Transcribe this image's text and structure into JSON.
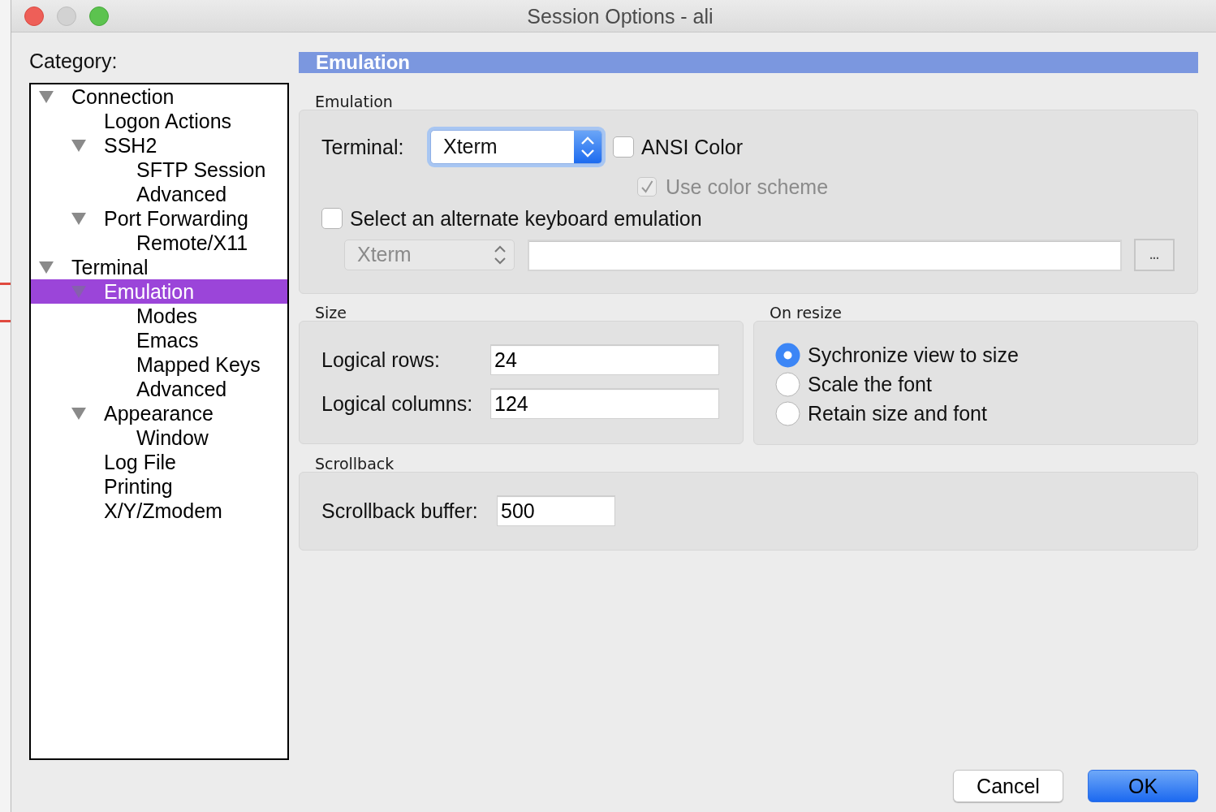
{
  "window": {
    "title": "Session Options - ali",
    "controls": [
      {
        "kind": "close",
        "disabled": false
      },
      {
        "kind": "minimize",
        "disabled": true
      },
      {
        "kind": "zoom",
        "disabled": false
      }
    ]
  },
  "category_tree": {
    "label": "Category:",
    "items": [
      {
        "label": "Connection",
        "expanded": true,
        "selected": false,
        "children": [
          {
            "label": "Logon Actions",
            "selected": false
          },
          {
            "label": "SSH2",
            "expanded": true,
            "selected": false,
            "children": [
              {
                "label": "SFTP Session",
                "selected": false
              },
              {
                "label": "Advanced",
                "selected": false
              }
            ]
          },
          {
            "label": "Port Forwarding",
            "expanded": true,
            "selected": false,
            "children": [
              {
                "label": "Remote/X11",
                "selected": false
              }
            ]
          }
        ]
      },
      {
        "label": "Terminal",
        "expanded": true,
        "selected": false,
        "children": [
          {
            "label": "Emulation",
            "expanded": true,
            "selected": true,
            "children": [
              {
                "label": "Modes",
                "selected": false
              },
              {
                "label": "Emacs",
                "selected": false
              },
              {
                "label": "Mapped Keys",
                "selected": false
              },
              {
                "label": "Advanced",
                "selected": false
              }
            ]
          },
          {
            "label": "Appearance",
            "expanded": true,
            "selected": false,
            "children": [
              {
                "label": "Window",
                "selected": false
              }
            ]
          },
          {
            "label": "Log File",
            "selected": false
          },
          {
            "label": "Printing",
            "selected": false
          },
          {
            "label": "X/Y/Zmodem",
            "selected": false
          }
        ]
      }
    ]
  },
  "panel": {
    "heading": "Emulation",
    "emulation_group": {
      "title": "Emulation",
      "terminal": {
        "label": "Terminal:",
        "value": "Xterm",
        "focused": true
      },
      "ansi_color": {
        "label": "ANSI Color",
        "checked": false,
        "disabled": false
      },
      "use_color_scheme": {
        "label": "Use color scheme",
        "checked": true,
        "disabled": true
      },
      "alternate_keyboard": {
        "label": "Select an alternate keyboard emulation",
        "checked": false,
        "disabled": false
      },
      "alternate_emulation": {
        "value": "Xterm",
        "disabled": true
      },
      "browse_button": {
        "label": "..."
      }
    },
    "size_group": {
      "title": "Size",
      "fields": [
        {
          "label": "Logical rows:",
          "value": "24"
        },
        {
          "label": "Logical columns:",
          "value": "124"
        }
      ]
    },
    "resize_group": {
      "title": "On resize",
      "options": [
        {
          "label": "Sychronize view to size",
          "selected": true
        },
        {
          "label": "Scale the font",
          "selected": false
        },
        {
          "label": "Retain size and font",
          "selected": false
        }
      ]
    },
    "scrollback_group": {
      "title": "Scrollback",
      "fields": [
        {
          "label": "Scrollback buffer:",
          "value": "500"
        }
      ]
    }
  },
  "buttons": [
    {
      "label": "Cancel",
      "kind": "default"
    },
    {
      "label": "OK",
      "kind": "primary"
    }
  ]
}
